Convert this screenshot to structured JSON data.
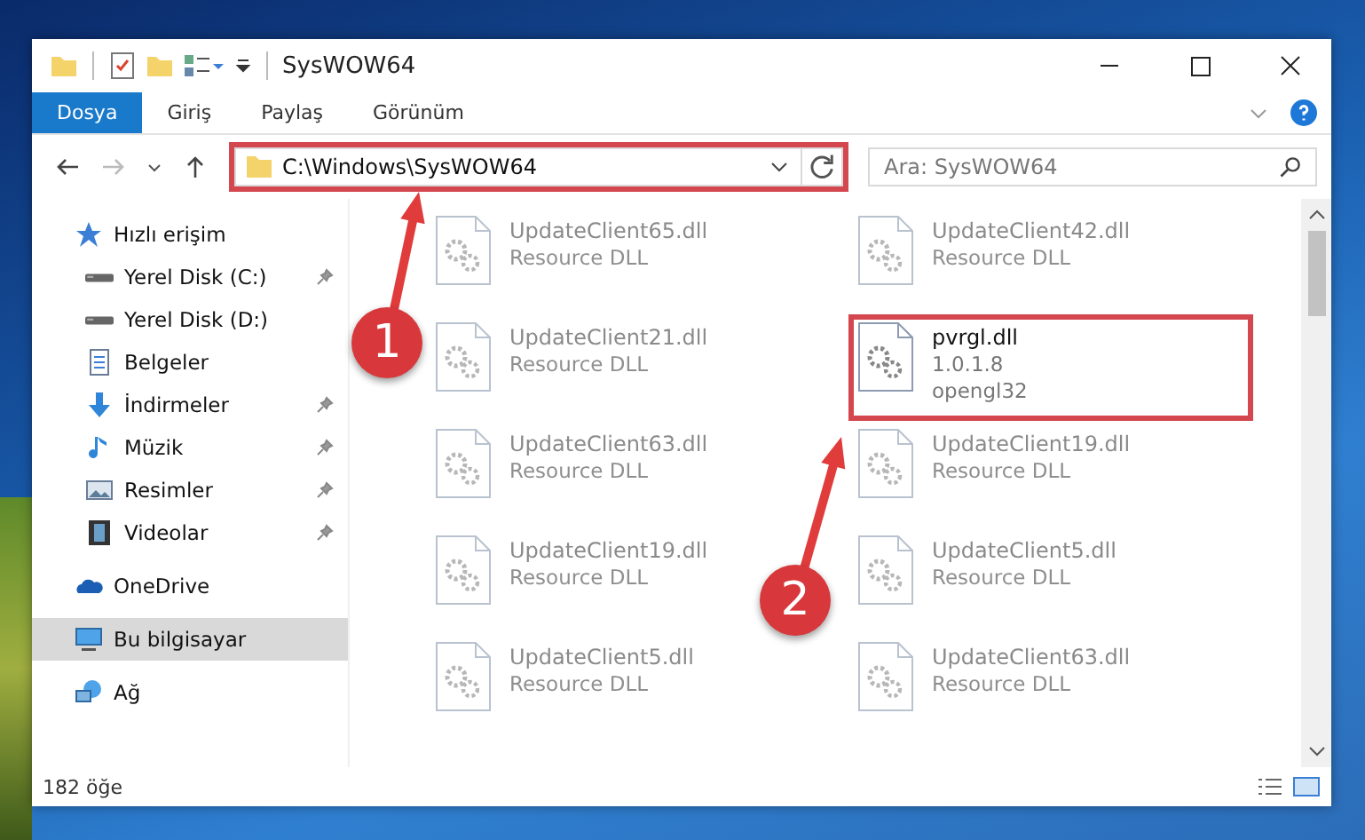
{
  "window": {
    "title": "SysWOW64"
  },
  "ribbon_tabs": [
    {
      "label": "Dosya",
      "selected": true
    },
    {
      "label": "Giriş",
      "selected": false
    },
    {
      "label": "Paylaş",
      "selected": false
    },
    {
      "label": "Görünüm",
      "selected": false
    }
  ],
  "address_bar": {
    "path": "C:\\Windows\\SysWOW64",
    "highlighted": true
  },
  "search": {
    "placeholder": "Ara: SysWOW64"
  },
  "sidebar": {
    "items": [
      {
        "label": "Hızlı erişim",
        "kind": "star",
        "selected": false,
        "children": [
          {
            "label": "Yerel Disk (C:)",
            "kind": "drive",
            "pinned": true,
            "selected": false
          },
          {
            "label": "Yerel Disk (D:)",
            "kind": "drive",
            "pinned": false,
            "selected": false
          },
          {
            "label": "Belgeler",
            "kind": "document",
            "pinned": false,
            "selected": false
          },
          {
            "label": "İndirmeler",
            "kind": "download",
            "pinned": true,
            "selected": false
          },
          {
            "label": "Müzik",
            "kind": "music",
            "pinned": true,
            "selected": false
          },
          {
            "label": "Resimler",
            "kind": "picture",
            "pinned": true,
            "selected": false
          },
          {
            "label": "Videolar",
            "kind": "video",
            "pinned": true,
            "selected": false
          }
        ]
      },
      {
        "label": "OneDrive",
        "kind": "cloud",
        "selected": false
      },
      {
        "label": "Bu bilgisayar",
        "kind": "computer",
        "selected": true
      },
      {
        "label": "Ağ",
        "kind": "network",
        "selected": false
      }
    ]
  },
  "files": [
    {
      "name": "UpdateClient65.dll",
      "lines": [
        "Resource DLL"
      ],
      "blurred": true,
      "highlighted": false
    },
    {
      "name": "UpdateClient42.dll",
      "lines": [
        "Resource DLL"
      ],
      "blurred": true,
      "highlighted": false
    },
    {
      "name": "UpdateClient21.dll",
      "lines": [
        "Resource DLL"
      ],
      "blurred": true,
      "highlighted": false
    },
    {
      "name": "pvrgl.dll",
      "lines": [
        "1.0.1.8",
        "opengl32"
      ],
      "blurred": false,
      "highlighted": true
    },
    {
      "name": "UpdateClient63.dll",
      "lines": [
        "Resource DLL"
      ],
      "blurred": true,
      "highlighted": false
    },
    {
      "name": "UpdateClient19.dll",
      "lines": [
        "Resource DLL"
      ],
      "blurred": true,
      "highlighted": false
    },
    {
      "name": "UpdateClient19.dll",
      "lines": [
        "Resource DLL"
      ],
      "blurred": true,
      "highlighted": false
    },
    {
      "name": "UpdateClient5.dll",
      "lines": [
        "Resource DLL"
      ],
      "blurred": true,
      "highlighted": false
    },
    {
      "name": "UpdateClient5.dll",
      "lines": [
        "Resource DLL"
      ],
      "blurred": true,
      "highlighted": false
    },
    {
      "name": "UpdateClient63.dll",
      "lines": [
        "Resource DLL"
      ],
      "blurred": true,
      "highlighted": false
    }
  ],
  "status_bar": {
    "count": "182 öğe"
  },
  "annotations": [
    {
      "label": "1"
    },
    {
      "label": "2"
    }
  ]
}
